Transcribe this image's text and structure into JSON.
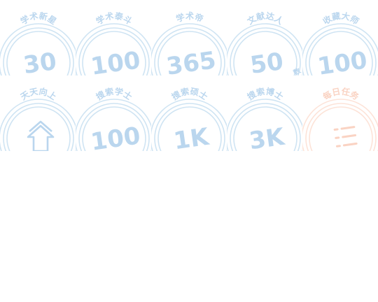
{
  "colors": {
    "earned": "#cfe4f3",
    "earned_text": "#bad6ee",
    "task": "#fde3d8",
    "task_text": "#fad3c3"
  },
  "badges": [
    {
      "title": "学术新星",
      "value": "30",
      "state": "earned"
    },
    {
      "title": "学术泰斗",
      "value": "100",
      "state": "earned"
    },
    {
      "title": "学术帝",
      "value": "365",
      "state": "earned"
    },
    {
      "title": "文献达人",
      "value": "50",
      "note": "数",
      "state": "earned"
    },
    {
      "title": "收藏大师",
      "value": "100",
      "state": "earned"
    },
    {
      "title": "天天向上",
      "icon": "arrow-up-icon",
      "state": "earned"
    },
    {
      "title": "搜索学士",
      "value": "100",
      "state": "earned"
    },
    {
      "title": "搜索硕士",
      "value": "1K",
      "state": "earned"
    },
    {
      "title": "搜索博士",
      "value": "3K",
      "state": "earned"
    },
    {
      "title": "每日任务",
      "icon": "list-icon",
      "state": "task"
    }
  ]
}
